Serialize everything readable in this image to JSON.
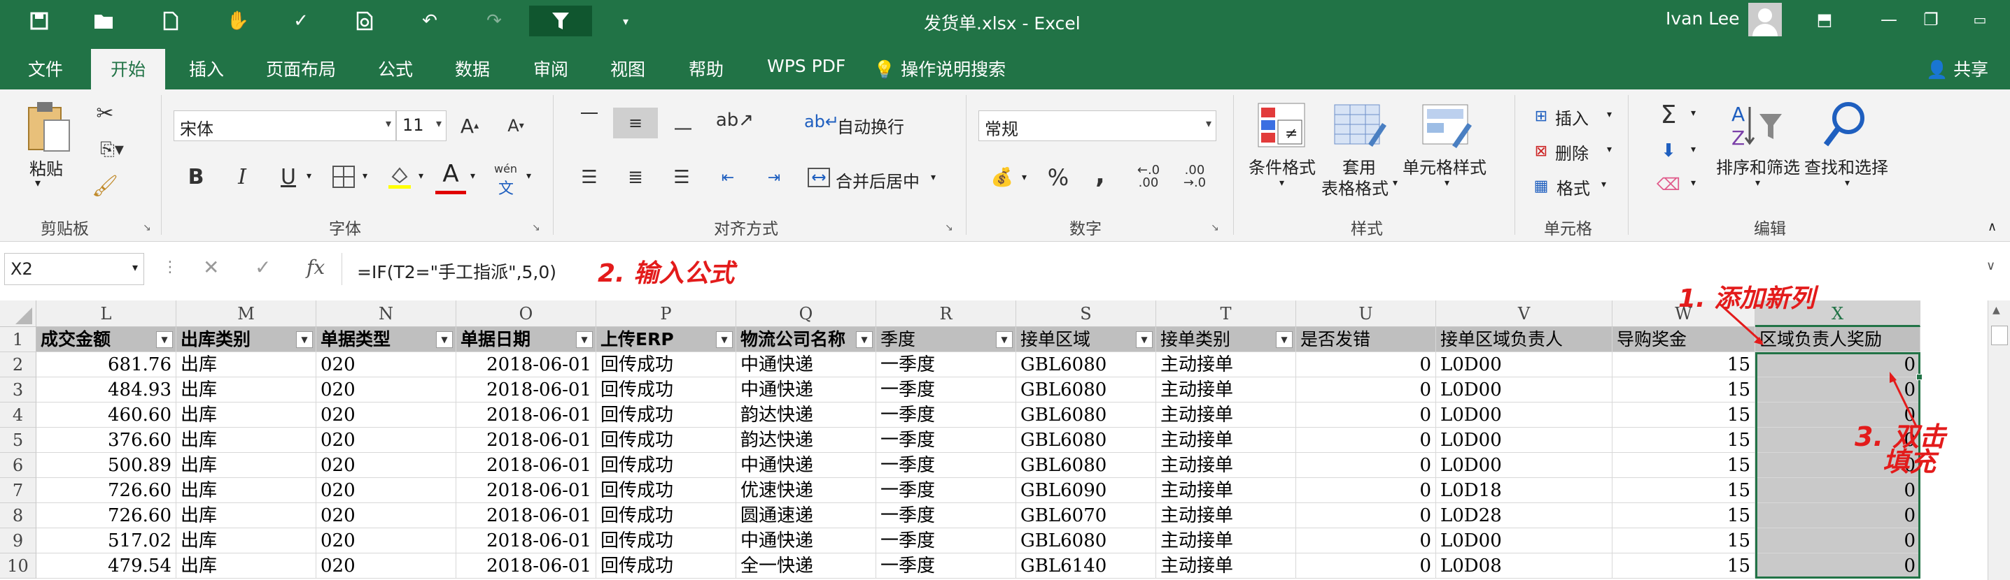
{
  "titlebar": {
    "doc_title": "发货单.xlsx  -  Excel",
    "user_name": "Ivan Lee",
    "quick_icons": [
      "save-icon",
      "open-icon",
      "new-icon",
      "touch-mode-icon",
      "spellcheck-icon",
      "print-preview-icon",
      "undo-icon",
      "redo-icon",
      "filter-icon",
      "customize-icon"
    ]
  },
  "tabs": {
    "items": [
      "文件",
      "开始",
      "插入",
      "页面布局",
      "公式",
      "数据",
      "审阅",
      "视图",
      "帮助",
      "WPS PDF"
    ],
    "active": "开始",
    "tell_me": "操作说明搜索",
    "share": "共享"
  },
  "ribbon": {
    "clipboard": {
      "paste": "粘贴",
      "label": "剪贴板"
    },
    "font": {
      "name": "宋体",
      "size": "11",
      "label": "字体",
      "bold": "B",
      "italic": "I",
      "underline": "U",
      "phonetic": "wén"
    },
    "alignment": {
      "wrap": "自动换行",
      "merge": "合并后居中",
      "label": "对齐方式"
    },
    "number": {
      "format": "常规",
      "percent": "%",
      "comma": ",",
      "label": "数字"
    },
    "styles": {
      "conditional": "条件格式",
      "table1": "套用",
      "table2": "表格格式",
      "cell_styles": "单元格样式",
      "label": "样式"
    },
    "cells": {
      "insert": "插入",
      "delete": "删除",
      "format": "格式",
      "label": "单元格"
    },
    "editing": {
      "sort": "排序和筛选",
      "find": "查找和选择",
      "label": "编辑"
    }
  },
  "formula_bar": {
    "name_box": "X2",
    "fx": "fx",
    "formula": "=IF(T2=\"手工指派\",5,0)"
  },
  "annotations": {
    "step1": "1. 添加新列",
    "step2": "2. 输入公式",
    "step3a": "3. 双击",
    "step3b": "填充"
  },
  "sheet": {
    "columns": [
      "L",
      "M",
      "N",
      "O",
      "P",
      "Q",
      "R",
      "S",
      "T",
      "U",
      "V",
      "W",
      "X"
    ],
    "header": [
      "成交金额",
      "出库类别",
      "单据类型",
      "单据日期",
      "上传ERP",
      "物流公司名称",
      "季度",
      "接单区域",
      "接单类别",
      "是否发错",
      "接单区域负责人",
      "导购奖金",
      "区域负责人奖励"
    ],
    "row_numbers": [
      "1",
      "2",
      "3",
      "4",
      "5",
      "6",
      "7",
      "8",
      "9",
      "10"
    ],
    "rows": [
      [
        "681.76",
        "出库",
        "020",
        "2018-06-01",
        "回传成功",
        "中通快递",
        "一季度",
        "GBL6080",
        "主动接单",
        "0",
        "L0D00",
        "15",
        "0"
      ],
      [
        "484.93",
        "出库",
        "020",
        "2018-06-01",
        "回传成功",
        "中通快递",
        "一季度",
        "GBL6080",
        "主动接单",
        "0",
        "L0D00",
        "15",
        "0"
      ],
      [
        "460.60",
        "出库",
        "020",
        "2018-06-01",
        "回传成功",
        "韵达快递",
        "一季度",
        "GBL6080",
        "主动接单",
        "0",
        "L0D00",
        "15",
        "0"
      ],
      [
        "376.60",
        "出库",
        "020",
        "2018-06-01",
        "回传成功",
        "韵达快递",
        "一季度",
        "GBL6080",
        "主动接单",
        "0",
        "L0D00",
        "15",
        "0"
      ],
      [
        "500.89",
        "出库",
        "020",
        "2018-06-01",
        "回传成功",
        "中通快递",
        "一季度",
        "GBL6080",
        "主动接单",
        "0",
        "L0D00",
        "15",
        "0"
      ],
      [
        "726.60",
        "出库",
        "020",
        "2018-06-01",
        "回传成功",
        "优速快递",
        "一季度",
        "GBL6090",
        "主动接单",
        "0",
        "L0D18",
        "15",
        "0"
      ],
      [
        "726.60",
        "出库",
        "020",
        "2018-06-01",
        "回传成功",
        "圆通速递",
        "一季度",
        "GBL6070",
        "主动接单",
        "0",
        "L0D28",
        "15",
        "0"
      ],
      [
        "517.02",
        "出库",
        "020",
        "2018-06-01",
        "回传成功",
        "中通快递",
        "一季度",
        "GBL6080",
        "主动接单",
        "0",
        "L0D00",
        "15",
        "0"
      ],
      [
        "479.54",
        "出库",
        "020",
        "2018-06-01",
        "回传成功",
        "全一快递",
        "一季度",
        "GBL6140",
        "主动接单",
        "0",
        "L0D08",
        "15",
        "0"
      ]
    ]
  },
  "colors": {
    "accent": "#217346",
    "annotation": "#e31b1b"
  }
}
